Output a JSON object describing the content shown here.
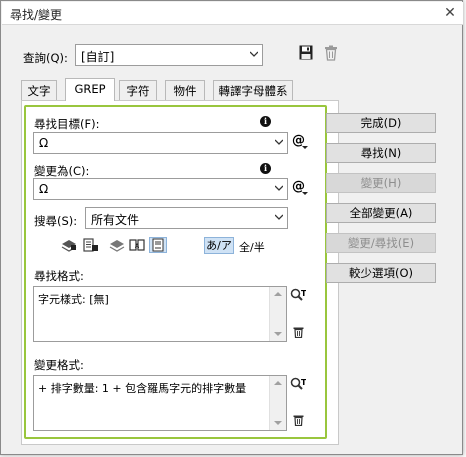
{
  "window": {
    "title": "尋找/變更",
    "close_glyph": "✕"
  },
  "query": {
    "label": "查詢(Q):",
    "value": "[自訂]"
  },
  "tabs": [
    {
      "label": "文字"
    },
    {
      "label": "GREP"
    },
    {
      "label": "字符"
    },
    {
      "label": "物件"
    },
    {
      "label": "轉譯字母體系"
    }
  ],
  "find_what": {
    "label": "尋找目標(F):",
    "value": "Ω",
    "at_glyph": "@"
  },
  "change_to": {
    "label": "變更為(C):",
    "value": "Ω",
    "at_glyph": "@"
  },
  "search": {
    "label": "搜尋(S):",
    "value": "所有文件"
  },
  "options": {
    "kana_label": "あ/ア",
    "width_label": "全/半"
  },
  "find_format": {
    "label": "尋找格式:",
    "text": "字元樣式: [無]"
  },
  "change_format": {
    "label": "變更格式:",
    "text": "+ 排字數量: 1 + 包含羅馬字元的排字數量"
  },
  "buttons": {
    "done": "完成(D)",
    "find": "尋找(N)",
    "change": "變更(H)",
    "change_all": "全部變更(A)",
    "change_find": "變更/尋找(E)",
    "fewer_options": "較少選項(O)"
  },
  "info_glyph": "i",
  "colors": {
    "highlight_border": "#99c63d",
    "dialog_bg": "#f0f0f0"
  }
}
